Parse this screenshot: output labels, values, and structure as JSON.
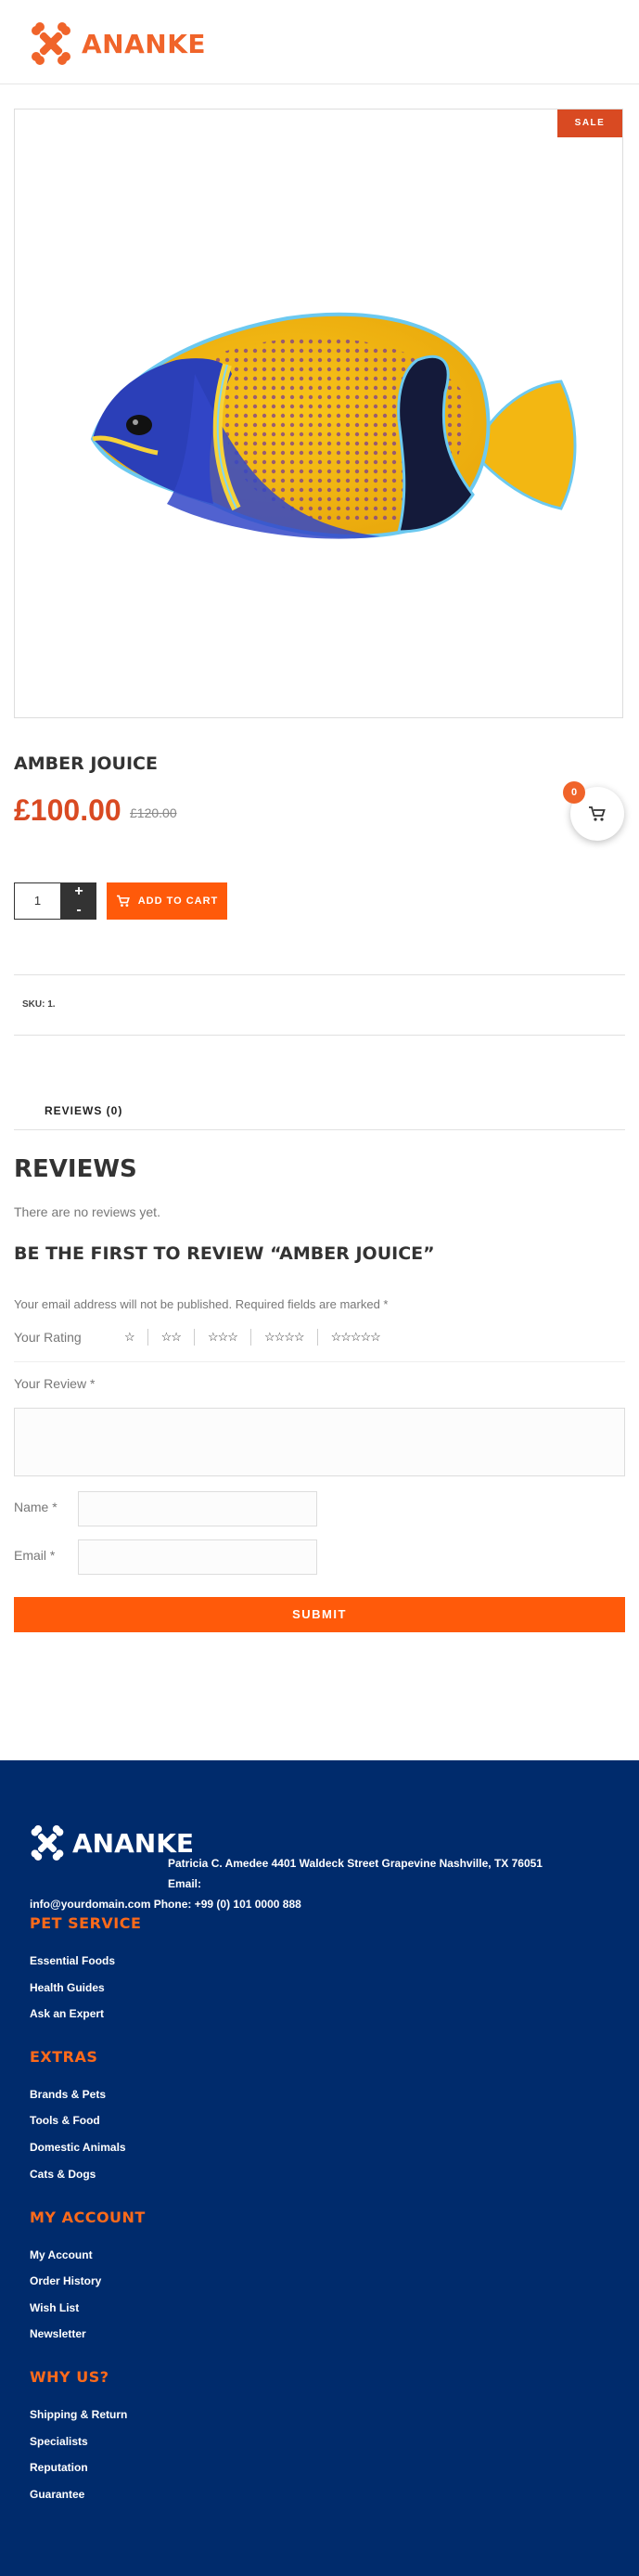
{
  "header": {
    "brand": "ANANKE"
  },
  "product": {
    "badge": "SALE",
    "title": "AMBER JOUICE",
    "price": "£100.00",
    "old_price": "£120.00",
    "cart_count": "0",
    "quantity": "1",
    "qty_plus": "+",
    "qty_minus": "-",
    "add_to_cart": "ADD TO CART",
    "sku": "SKU: 1."
  },
  "tabs": [
    {
      "label": "REVIEWS (0)"
    }
  ],
  "reviews": {
    "heading": "REVIEWS",
    "empty": "There are no reviews yet.",
    "form_title": "BE THE FIRST TO REVIEW “AMBER JOUICE”",
    "note": "Your email address will not be published. Required fields are marked *",
    "rating_label": "Your Rating",
    "rating_options": [
      "☆",
      "☆☆",
      "☆☆☆",
      "☆☆☆☆",
      "☆☆☆☆☆"
    ],
    "review_label": "Your Review *",
    "name_label": "Name *",
    "email_label": "Email *",
    "submit": "SUBMIT"
  },
  "footer": {
    "brand": "ANANKE",
    "address_line1": "Patricia C. Amedee 4401 Waldeck Street Grapevine Nashville, TX 76051 Email:",
    "address_line2": "info@yourdomain.com Phone: +99 (0) 101 0000 888",
    "sections": [
      {
        "title": "PET SERVICE",
        "links": [
          "Essential Foods",
          "Health Guides",
          "Ask an Expert"
        ]
      },
      {
        "title": "EXTRAS",
        "links": [
          "Brands & Pets",
          "Tools & Food",
          "Domestic Animals",
          "Cats & Dogs"
        ]
      },
      {
        "title": "MY ACCOUNT",
        "links": [
          "My Account",
          "Order History",
          "Wish List",
          "Newsletter"
        ]
      },
      {
        "title": "WHY US?",
        "links": [
          "Shipping & Return",
          "Specialists",
          "Reputation",
          "Guarantee"
        ]
      }
    ]
  },
  "colors": {
    "accent": "#ff5a0a",
    "sale": "#d94a22",
    "footer_bg": "#002b6c",
    "footer_heading": "#ff6a1a"
  }
}
